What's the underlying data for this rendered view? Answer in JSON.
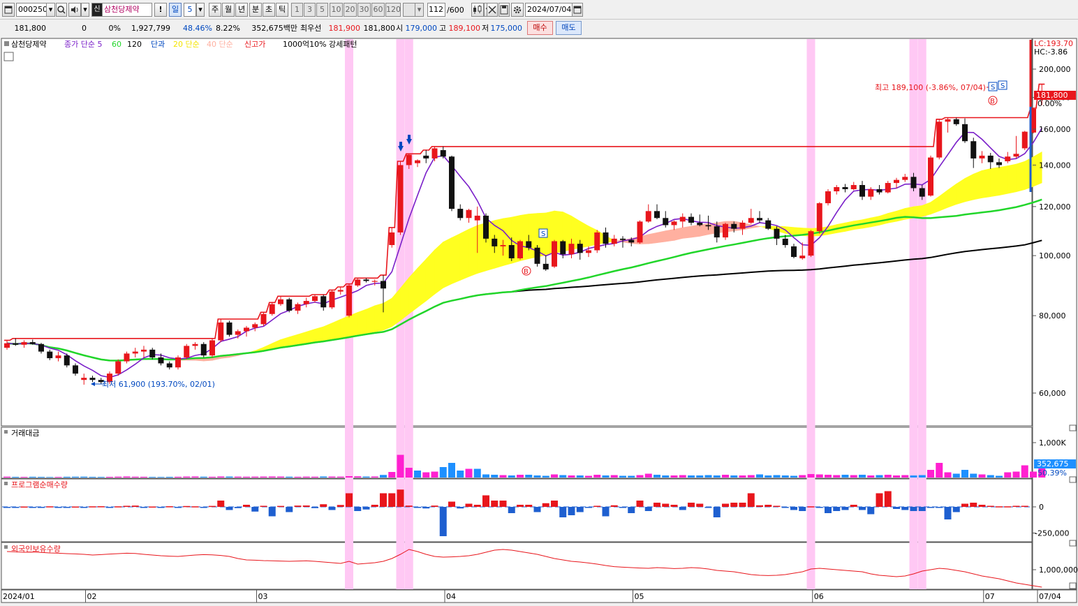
{
  "toolbar": {
    "code": "000250",
    "stock_badge": "신",
    "stock_name": "삼천당제약",
    "interval_value": "5",
    "periods": [
      "주",
      "월",
      "년",
      "분",
      "초",
      "틱"
    ],
    "minute_buttons": [
      "1",
      "3",
      "5",
      "10",
      "20",
      "30",
      "60",
      "120"
    ],
    "count": "112",
    "count_total": "/600",
    "date": "2024/07/04",
    "bang": "!",
    "il": "일",
    "icons": [
      "window-icon",
      "dropdown-icon",
      "search-icon",
      "speaker-icon",
      "stock-type-icon",
      "candle-icon",
      "tools-icon",
      "save-icon",
      "gear-icon",
      "calendar-icon"
    ]
  },
  "info": {
    "price": "181,800",
    "change": "0",
    "change_pct": "0%",
    "volume": "1,927,799",
    "vol_ratio": "48.46%",
    "turnover": "8.22%",
    "amount": "352,675백만",
    "best_ask_label": "최우선",
    "best_ask": "181,900",
    "best_bid": "181,800",
    "open_label": "시",
    "open": "179,000",
    "high_label": "고",
    "high": "189,100",
    "low_label": "저",
    "low": "175,000",
    "buy_label": "매수",
    "sell_label": "매도"
  },
  "legend": {
    "name": "삼천당제약",
    "close_ma": "종가 단순 5",
    "ma60": "60",
    "ma120": "120",
    "danggwa": "단과",
    "ma20_simple": "20 단순",
    "ma40_simple": "40 단순",
    "new_high": "신고가",
    "pattern": "1000억10% 강세패턴"
  },
  "annotations": {
    "high_note": "최고 189,100 (-3.86%, 07/04)",
    "low_note": "최저 61,900 (193.70%, 02/01)",
    "lc": "LC:193.70",
    "hc": "HC:-3.86",
    "price_tag": "181,800",
    "zero_pct": "0.00%"
  },
  "axes": {
    "price_ticks": [
      {
        "label": "200,000",
        "v": 200000
      },
      {
        "label": "180,000",
        "v": 180000
      },
      {
        "label": "160,000",
        "v": 160000
      },
      {
        "label": "140,000",
        "v": 140000
      },
      {
        "label": "120,000",
        "v": 120000
      },
      {
        "label": "100,000",
        "v": 100000
      },
      {
        "label": "80,000",
        "v": 80000
      },
      {
        "label": "60,000",
        "v": 60000
      }
    ],
    "trade_ticks": [
      {
        "label": "1,000K",
        "v": 1000000
      }
    ],
    "trade_current": "352,675",
    "trade_pct": "50.39%",
    "program_ticks": [
      {
        "label": "0",
        "v": 0
      },
      {
        "label": "-250,000",
        "v": -250000
      }
    ],
    "foreign_ticks": [
      {
        "label": "1,000,000",
        "v": 1000000
      }
    ],
    "date_labels": [
      {
        "label": "2024/01",
        "i": 0
      },
      {
        "label": "02",
        "i": 10
      },
      {
        "label": "03",
        "i": 30
      },
      {
        "label": "04",
        "i": 52
      },
      {
        "label": "05",
        "i": 74
      },
      {
        "label": "06",
        "i": 95
      },
      {
        "label": "07",
        "i": 115
      },
      {
        "label": "07/04",
        "i": 118
      }
    ]
  },
  "panels": {
    "trade_amount": "거래대금",
    "program_net": "프로그램순매수량",
    "foreign_holdings": "외국인보유수량"
  },
  "colors": {
    "up": "#e8161c",
    "down": "#111111",
    "ma5": "#7a1fc9",
    "ma60": "#21d62a",
    "ma120": "#000000",
    "cloud": "#ffff20",
    "cloud_neg": "#ffb0a0",
    "highlight": "#ffc8f4",
    "newhigh": "#e8161c",
    "vol_blue": "#1e90ff",
    "vol_pink": "#ff20d0",
    "prog_up": "#e8161c",
    "prog_down": "#1e5fd0",
    "foreign": "#e8161c"
  },
  "chart_data": {
    "type": "candlestick",
    "title": "삼천당제약",
    "highlight_indices": [
      40,
      46,
      47,
      94,
      106,
      107
    ],
    "candles": [
      [
        71000,
        73000,
        70500,
        72200
      ],
      [
        72200,
        73500,
        71500,
        71800
      ],
      [
        71800,
        73000,
        71000,
        72500
      ],
      [
        72500,
        73200,
        71800,
        72000
      ],
      [
        72000,
        72300,
        69500,
        70000
      ],
      [
        70000,
        70500,
        67800,
        68300
      ],
      [
        68300,
        70000,
        67500,
        69000
      ],
      [
        69000,
        69500,
        66000,
        66500
      ],
      [
        66500,
        67000,
        64000,
        64500
      ],
      [
        63000,
        64500,
        61900,
        63500
      ],
      [
        63500,
        64000,
        62500,
        63000
      ],
      [
        63000,
        63500,
        62000,
        62500
      ],
      [
        62500,
        65000,
        62000,
        64500
      ],
      [
        64500,
        68000,
        64000,
        67500
      ],
      [
        67500,
        70000,
        67000,
        69500
      ],
      [
        69500,
        71000,
        68500,
        70000
      ],
      [
        70000,
        71500,
        68500,
        70500
      ],
      [
        70500,
        71000,
        68000,
        68500
      ],
      [
        68500,
        69500,
        66500,
        67000
      ],
      [
        67000,
        67500,
        65500,
        66000
      ],
      [
        66000,
        69000,
        65500,
        68500
      ],
      [
        68500,
        72000,
        68000,
        71500
      ],
      [
        71500,
        72500,
        70500,
        72000
      ],
      [
        72000,
        72500,
        68500,
        69000
      ],
      [
        69000,
        73500,
        68500,
        73000
      ],
      [
        73000,
        79000,
        72500,
        78000
      ],
      [
        78000,
        78500,
        74000,
        74500
      ],
      [
        74500,
        76000,
        73500,
        75500
      ],
      [
        75500,
        77000,
        74000,
        76500
      ],
      [
        76500,
        78000,
        75500,
        77500
      ],
      [
        77500,
        81000,
        77000,
        80500
      ],
      [
        80500,
        84000,
        80000,
        83500
      ],
      [
        83500,
        86000,
        83000,
        85000
      ],
      [
        85000,
        85500,
        81000,
        81500
      ],
      [
        81500,
        84000,
        80500,
        83500
      ],
      [
        83500,
        85500,
        82500,
        84500
      ],
      [
        84500,
        86500,
        84000,
        86000
      ],
      [
        86000,
        86500,
        81500,
        82500
      ],
      [
        82500,
        88000,
        82000,
        87500
      ],
      [
        87500,
        89000,
        86500,
        88000
      ],
      [
        80000,
        90000,
        79500,
        89500
      ],
      [
        89500,
        92000,
        89000,
        91500
      ],
      [
        91500,
        92000,
        90500,
        91000
      ],
      [
        91000,
        91500,
        89500,
        91000
      ],
      [
        91000,
        93000,
        81000,
        88500
      ],
      [
        104000,
        111000,
        103000,
        109000
      ],
      [
        109000,
        142000,
        108000,
        140000
      ],
      [
        140000,
        146000,
        138000,
        145500
      ],
      [
        141000,
        143000,
        139000,
        142500
      ],
      [
        145000,
        148000,
        141000,
        143500
      ],
      [
        143500,
        150000,
        142000,
        149000
      ],
      [
        148000,
        150000,
        143500,
        144500
      ],
      [
        144500,
        145000,
        118000,
        119000
      ],
      [
        119000,
        121000,
        114000,
        115000
      ],
      [
        115000,
        119000,
        113000,
        118500
      ],
      [
        114000,
        120000,
        101000,
        116000
      ],
      [
        116000,
        117000,
        105000,
        106500
      ],
      [
        106500,
        108000,
        101000,
        103500
      ],
      [
        103500,
        106000,
        100000,
        104000
      ],
      [
        104000,
        107000,
        98000,
        99000
      ],
      [
        99000,
        106000,
        98500,
        105500
      ],
      [
        105500,
        108000,
        102000,
        103000
      ],
      [
        103000,
        104000,
        96000,
        97000
      ],
      [
        97000,
        100000,
        94500,
        95000
      ],
      [
        96000,
        106000,
        95500,
        105500
      ],
      [
        105500,
        106000,
        99000,
        100500
      ],
      [
        100500,
        106500,
        99000,
        104500
      ],
      [
        104500,
        106000,
        98500,
        101000
      ],
      [
        101000,
        103500,
        99500,
        102000
      ],
      [
        102000,
        110000,
        101000,
        109000
      ],
      [
        109000,
        111000,
        103000,
        104500
      ],
      [
        104500,
        108000,
        103500,
        106500
      ],
      [
        106500,
        107500,
        103000,
        106000
      ],
      [
        106000,
        107000,
        103500,
        105000
      ],
      [
        105000,
        114000,
        104500,
        113500
      ],
      [
        113500,
        121000,
        113000,
        118000
      ],
      [
        118000,
        121000,
        114500,
        115000
      ],
      [
        115000,
        118000,
        111000,
        112000
      ],
      [
        112000,
        114000,
        110000,
        113500
      ],
      [
        113500,
        117000,
        111000,
        115500
      ],
      [
        115500,
        117000,
        112000,
        113000
      ],
      [
        113000,
        116500,
        111500,
        112000
      ],
      [
        112000,
        116000,
        110000,
        111500
      ],
      [
        111500,
        113500,
        105000,
        107000
      ],
      [
        107000,
        113000,
        106000,
        112500
      ],
      [
        112500,
        113500,
        109000,
        110500
      ],
      [
        110500,
        114000,
        108000,
        113000
      ],
      [
        113000,
        119000,
        112500,
        115000
      ],
      [
        115000,
        118000,
        113000,
        114000
      ],
      [
        114000,
        115000,
        110000,
        110500
      ],
      [
        110500,
        111500,
        104000,
        106500
      ],
      [
        106500,
        108000,
        103000,
        104000
      ],
      [
        103500,
        104500,
        99000,
        99500
      ],
      [
        99000,
        105000,
        98500,
        100000
      ],
      [
        100000,
        110000,
        99500,
        109500
      ],
      [
        109500,
        122000,
        108500,
        121500
      ],
      [
        121500,
        128000,
        120500,
        127000
      ],
      [
        127000,
        130000,
        125500,
        129000
      ],
      [
        129000,
        130500,
        126500,
        128000
      ],
      [
        128000,
        131500,
        127500,
        130000
      ],
      [
        130000,
        132000,
        123000,
        124500
      ],
      [
        124500,
        129000,
        123000,
        128000
      ],
      [
        128000,
        130000,
        125500,
        126500
      ],
      [
        126500,
        132000,
        126000,
        131000
      ],
      [
        131000,
        133500,
        128500,
        132500
      ],
      [
        132500,
        135500,
        131500,
        134000
      ],
      [
        134000,
        136000,
        127000,
        128500
      ],
      [
        128500,
        130000,
        123000,
        124500
      ],
      [
        125000,
        145000,
        124500,
        144000
      ],
      [
        144000,
        166000,
        143000,
        164500
      ],
      [
        164500,
        167000,
        158000,
        166000
      ],
      [
        166000,
        167000,
        162000,
        163000
      ],
      [
        163000,
        166500,
        152000,
        153000
      ],
      [
        153000,
        155000,
        138500,
        143500
      ],
      [
        143500,
        147500,
        141000,
        145000
      ],
      [
        145000,
        146500,
        138000,
        141500
      ],
      [
        141500,
        143500,
        138500,
        140000
      ],
      [
        142000,
        147000,
        141000,
        144500
      ],
      [
        144500,
        156000,
        143500,
        146000
      ],
      [
        149000,
        159000,
        148000,
        158500
      ],
      [
        158000,
        173000,
        157500,
        172500
      ],
      [
        179000,
        189100,
        175000,
        181800
      ]
    ],
    "volume_amount": [
      25000,
      20000,
      18000,
      22000,
      19000,
      15000,
      17000,
      22000,
      24000,
      25000,
      20000,
      18000,
      20000,
      25000,
      30000,
      24000,
      22000,
      18000,
      17000,
      20000,
      22000,
      28000,
      30000,
      24000,
      22000,
      30000,
      28000,
      26000,
      24000,
      26000,
      28000,
      30000,
      28000,
      24000,
      22000,
      26000,
      24000,
      30000,
      28000,
      26000,
      40000,
      35000,
      28000,
      30000,
      75000,
      160000,
      650000,
      280000,
      200000,
      150000,
      170000,
      300000,
      420000,
      200000,
      250000,
      250000,
      90000,
      80000,
      70000,
      60000,
      80000,
      80000,
      60000,
      50000,
      90000,
      70000,
      60000,
      60000,
      50000,
      80000,
      60000,
      70000,
      50000,
      50000,
      70000,
      110000,
      80000,
      60000,
      60000,
      70000,
      60000,
      60000,
      70000,
      60000,
      80000,
      60000,
      60000,
      70000,
      90000,
      60000,
      70000,
      60000,
      50000,
      70000,
      100000,
      90000,
      80000,
      70000,
      80000,
      70000,
      80000,
      60000,
      70000,
      80000,
      60000,
      70000,
      60000,
      70000,
      220000,
      420000,
      150000,
      110000,
      220000,
      110000,
      90000,
      70000,
      50000,
      150000,
      170000,
      350000,
      170000,
      352675
    ],
    "program_net": [
      -5000,
      -4000,
      3000,
      -2000,
      -3000,
      5000,
      -2000,
      -4000,
      3000,
      -2000,
      5000,
      6000,
      -3000,
      5000,
      10000,
      12000,
      -4000,
      3000,
      -2000,
      6000,
      -5000,
      8000,
      5000,
      -3000,
      9000,
      60000,
      -30000,
      -12000,
      20000,
      -45000,
      10000,
      -90000,
      9000,
      -50000,
      12000,
      13000,
      -12000,
      25000,
      -30000,
      18000,
      130000,
      -40000,
      -25000,
      20000,
      130000,
      130000,
      165000,
      12000,
      -10000,
      -15000,
      12000,
      -280000,
      50000,
      -15000,
      30000,
      20000,
      110000,
      60000,
      60000,
      -60000,
      20000,
      20000,
      -50000,
      35000,
      60000,
      -100000,
      -80000,
      -50000,
      -10000,
      10000,
      -90000,
      15000,
      -10000,
      -60000,
      60000,
      -40000,
      40000,
      30000,
      20000,
      -30000,
      40000,
      30000,
      -10000,
      -100000,
      30000,
      40000,
      40000,
      130000,
      15000,
      20000,
      10000,
      -10000,
      -30000,
      -40000,
      5000,
      -10000,
      -60000,
      -40000,
      -30000,
      20000,
      -30000,
      -70000,
      130000,
      150000,
      -20000,
      -30000,
      -40000,
      -40000,
      -10000,
      -10000,
      -120000,
      -50000,
      30000,
      40000,
      20000,
      10000,
      5000,
      5000,
      10000,
      10000
    ],
    "foreign_holdings": [
      1130000,
      1128000,
      1125000,
      1126000,
      1124000,
      1120000,
      1118000,
      1115000,
      1113000,
      1110000,
      1105000,
      1108000,
      1112000,
      1115000,
      1118000,
      1116000,
      1110000,
      1105000,
      1100000,
      1097000,
      1095000,
      1100000,
      1105000,
      1108000,
      1106000,
      1102000,
      1095000,
      1080000,
      1070000,
      1068000,
      1065000,
      1064000,
      1062000,
      1060000,
      1062000,
      1064000,
      1060000,
      1055000,
      1050000,
      1045000,
      1060000,
      1040000,
      1045000,
      1050000,
      1060000,
      1080000,
      1110000,
      1145000,
      1130000,
      1110000,
      1095000,
      1090000,
      1092000,
      1095000,
      1100000,
      1110000,
      1125000,
      1140000,
      1145000,
      1140000,
      1130000,
      1120000,
      1110000,
      1095000,
      1080000,
      1070000,
      1060000,
      1055000,
      1048000,
      1040000,
      1030000,
      1022000,
      1018000,
      1015000,
      1012000,
      1010000,
      1015000,
      1012000,
      1008000,
      1010000,
      1015000,
      1012000,
      1005000,
      995000,
      990000,
      985000,
      975000,
      965000,
      960000,
      958000,
      960000,
      965000,
      975000,
      985000,
      1005000,
      1010000,
      1005000,
      1000000,
      995000,
      990000,
      985000,
      970000,
      960000,
      955000,
      950000,
      955000,
      970000,
      990000,
      1000000,
      1010000,
      1005000,
      995000,
      985000,
      970000,
      955000,
      945000,
      935000,
      920000,
      905000,
      895000,
      885000,
      875000
    ]
  }
}
